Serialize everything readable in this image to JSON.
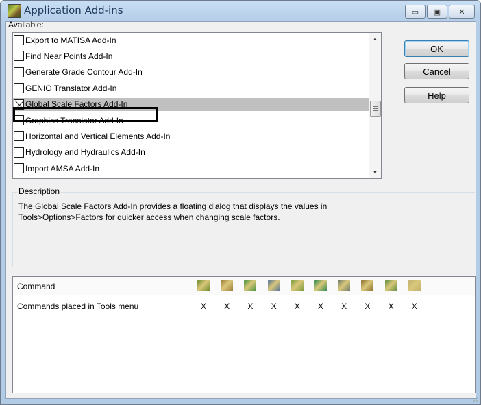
{
  "window": {
    "title": "Application Add-ins",
    "minimize_glyph": "▭",
    "maximize_glyph": "▣",
    "close_glyph": "✕"
  },
  "available_label": "Available:",
  "addins": [
    {
      "label": "Export to MATISA Add-In",
      "checked": false,
      "selected": false
    },
    {
      "label": "Find Near Points Add-In",
      "checked": false,
      "selected": false
    },
    {
      "label": "Generate Grade Contour Add-In",
      "checked": false,
      "selected": false
    },
    {
      "label": "GENIO Translator Add-In",
      "checked": false,
      "selected": false
    },
    {
      "label": "Global Scale Factors Add-In",
      "checked": true,
      "selected": true
    },
    {
      "label": "Graphics Translator Add-In",
      "checked": false,
      "selected": false
    },
    {
      "label": "Horizontal and Vertical Elements Add-In",
      "checked": false,
      "selected": false
    },
    {
      "label": "Hydrology and Hydraulics Add-In",
      "checked": false,
      "selected": false
    },
    {
      "label": "Import AMSA Add-In",
      "checked": false,
      "selected": false
    }
  ],
  "buttons": {
    "ok": "OK",
    "cancel": "Cancel",
    "help": "Help"
  },
  "description": {
    "legend": "Description",
    "text": "The Global Scale Factors Add-In provides a floating dialog that displays the values in Tools>Options>Factors for quicker access when changing scale factors."
  },
  "commands": {
    "header_label": "Command",
    "icons": [
      "road-icon",
      "terrain-icon",
      "grade-icon",
      "alignment-icon",
      "landscape-icon",
      "contour-icon",
      "survey-icon",
      "profile-icon",
      "cross-section-icon",
      "wand-icon"
    ],
    "icon_colors": [
      "#6b8a2a",
      "#9a7a3a",
      "#3f8f3a",
      "#4f6f9a",
      "#7a9a3a",
      "#2f8a4f",
      "#6a7a6a",
      "#8a6a2a",
      "#5a8a3a",
      "#c0b070"
    ],
    "rows": [
      {
        "label": "Commands placed in Tools menu",
        "marks": [
          "X",
          "X",
          "X",
          "X",
          "X",
          "X",
          "X",
          "X",
          "X",
          "X"
        ]
      }
    ]
  }
}
